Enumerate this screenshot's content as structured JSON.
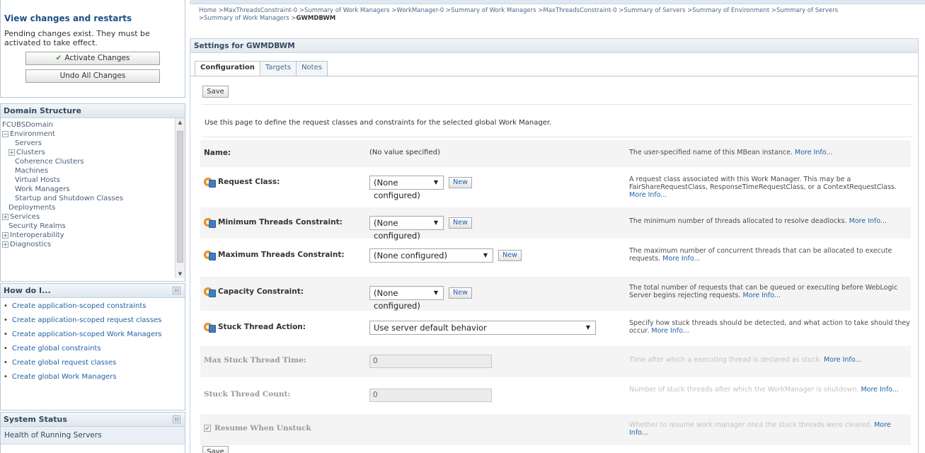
{
  "change_center": {
    "title": "View changes and restarts",
    "message": "Pending changes exist. They must be activated to take effect.",
    "activate_label": "Activate Changes",
    "undo_label": "Undo All Changes"
  },
  "domain_structure": {
    "title": "Domain Structure",
    "tree": [
      {
        "label": "FCUBSDomain",
        "indent": 0,
        "expander": ""
      },
      {
        "label": "Environment",
        "indent": 0,
        "expander": "−"
      },
      {
        "label": "Servers",
        "indent": 2,
        "expander": ""
      },
      {
        "label": "Clusters",
        "indent": 1,
        "expander": "+"
      },
      {
        "label": "Coherence Clusters",
        "indent": 2,
        "expander": ""
      },
      {
        "label": "Machines",
        "indent": 2,
        "expander": ""
      },
      {
        "label": "Virtual Hosts",
        "indent": 2,
        "expander": ""
      },
      {
        "label": "Work Managers",
        "indent": 2,
        "expander": ""
      },
      {
        "label": "Startup and Shutdown Classes",
        "indent": 2,
        "expander": ""
      },
      {
        "label": "Deployments",
        "indent": 1,
        "expander": ""
      },
      {
        "label": "Services",
        "indent": 0,
        "expander": "+"
      },
      {
        "label": "Security Realms",
        "indent": 1,
        "expander": ""
      },
      {
        "label": "Interoperability",
        "indent": 0,
        "expander": "+"
      },
      {
        "label": "Diagnostics",
        "indent": 0,
        "expander": "+"
      }
    ]
  },
  "how_do_i": {
    "title": "How do I...",
    "items": [
      "Create application-scoped constraints",
      "Create application-scoped request classes",
      "Create application-scoped Work Managers",
      "Create global constraints",
      "Create global request classes",
      "Create global Work Managers"
    ]
  },
  "system_status": {
    "title": "System Status",
    "health_label": "Health of Running Servers"
  },
  "breadcrumb": {
    "path": "Home >MaxThreadsConstraint-0 >Summary of Work Managers >WorkManager-0 >Summary of Work Managers >MaxThreadsConstraint-0 >Summary of Servers >Summary of Environment >Summary of Servers >Summary of Work Managers >",
    "current": "GWMDBWM"
  },
  "settings": {
    "title": "Settings for GWMDBWM",
    "tabs": [
      "Configuration",
      "Targets",
      "Notes"
    ],
    "save_label": "Save",
    "intro": "Use this page to define the request classes and constraints for the selected global Work Manager.",
    "more_info": "More Info...",
    "new_label": "New",
    "fields": {
      "name": {
        "label": "Name:",
        "value": "(No value specified)",
        "help": "The user-specified name of this MBean instance."
      },
      "request_class": {
        "label": "Request Class:",
        "value": "(None configured)",
        "help": "A request class associated with this Work Manager. This may be a FairShareRequestClass, ResponseTimeRequestClass, or a ContextRequestClass."
      },
      "min_threads": {
        "label": "Minimum Threads Constraint:",
        "value": "(None configured)",
        "help": "The minimum number of threads allocated to resolve deadlocks."
      },
      "max_threads": {
        "label": "Maximum Threads Constraint:",
        "value": "(None configured)",
        "help": "The maximum number of concurrent threads that can be allocated to execute requests."
      },
      "capacity": {
        "label": "Capacity Constraint:",
        "value": "(None configured)",
        "help": "The total number of requests that can be queued or executing before WebLogic Server begins rejecting requests."
      },
      "stuck_action": {
        "label": "Stuck Thread Action:",
        "value": "Use server default behavior",
        "help": "Specify how stuck threads should be detected, and what action to take should they occur."
      },
      "max_stuck_time": {
        "label": "Max Stuck Thread Time:",
        "value": "0",
        "help": "Time after which a executing thread is declared as stuck."
      },
      "stuck_count": {
        "label": "Stuck Thread Count:",
        "value": "0",
        "help": "Number of stuck threads after which the WorkManager is shutdown."
      },
      "resume": {
        "label": "Resume When Unstuck",
        "checked": true,
        "help": "Whether to resume work manager once the stuck threads were cleared."
      }
    }
  }
}
